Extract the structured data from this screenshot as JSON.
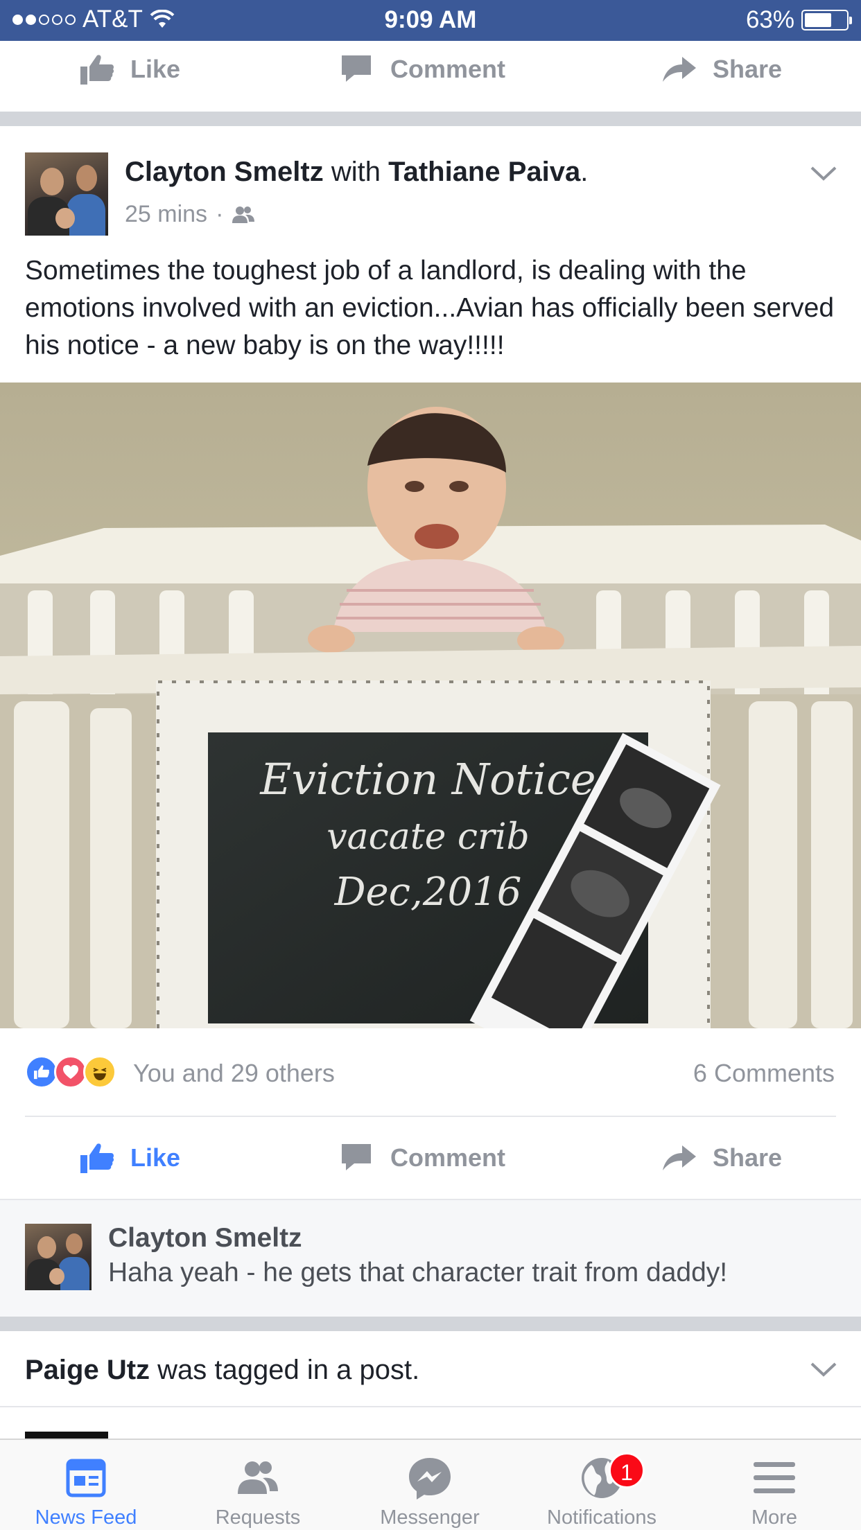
{
  "status_bar": {
    "carrier": "AT&T",
    "time": "9:09 AM",
    "battery": "63%",
    "signal_bars_filled": 2,
    "signal_bars_total": 5,
    "battery_level": 0.63
  },
  "top_actions": {
    "like": "Like",
    "comment": "Comment",
    "share": "Share"
  },
  "post": {
    "author": "Clayton Smeltz",
    "with_word": "with",
    "tagged": "Tathiane Paiva",
    "period": ".",
    "time": "25 mins",
    "separator": "·",
    "privacy_icon": "friends-icon",
    "text": "Sometimes the toughest job of a landlord, is dealing with the emotions involved with an eviction...Avian has officially been served his notice - a new baby is on the way!!!!!",
    "photo": {
      "chalkboard_line1": "Eviction Notice",
      "chalkboard_line2": "vacate crib",
      "chalkboard_line3": "Dec,2016"
    },
    "reactions_text": "You and 29 others",
    "comments_count": "6 Comments",
    "actions": {
      "like": "Like",
      "comment": "Comment",
      "share": "Share"
    },
    "comment_preview": {
      "author": "Clayton Smeltz",
      "text": "Haha yeah - he gets that character trait from daddy!"
    }
  },
  "next_story": {
    "name": "Paige Utz",
    "text": "was tagged in a post."
  },
  "tab_bar": {
    "tabs": [
      {
        "label": "News Feed",
        "icon": "news-feed-icon",
        "active": true
      },
      {
        "label": "Requests",
        "icon": "friend-requests-icon",
        "active": false
      },
      {
        "label": "Messenger",
        "icon": "messenger-icon",
        "active": false
      },
      {
        "label": "Notifications",
        "icon": "globe-icon",
        "active": false,
        "badge": "1"
      },
      {
        "label": "More",
        "icon": "menu-icon",
        "active": false
      }
    ]
  },
  "colors": {
    "status_bar": "#3b5998",
    "accent": "#4080ff",
    "muted": "#90949c",
    "badge": "#fa0a17"
  }
}
